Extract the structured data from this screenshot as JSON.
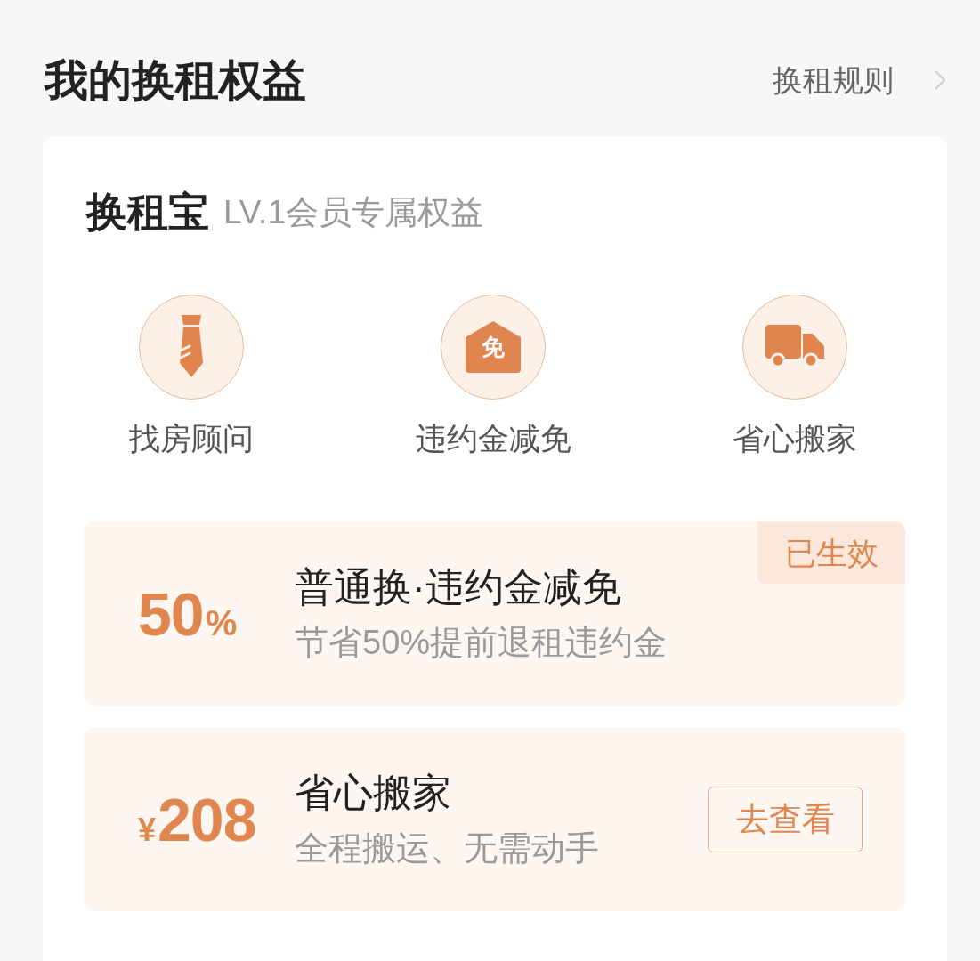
{
  "header": {
    "title": "我的换租权益",
    "link": "换租规则"
  },
  "card": {
    "name": "换租宝",
    "subtitle": "LV.1会员专属权益",
    "perks": [
      {
        "kind": "advisor",
        "label": "找房顾问"
      },
      {
        "kind": "waiver",
        "icon_text": "免",
        "label": "违约金减免"
      },
      {
        "kind": "moving",
        "label": "省心搬家"
      }
    ],
    "benefits": [
      {
        "number": "50",
        "suffix": "%",
        "title": "普通换·违约金减免",
        "description": "节省50%提前退租违约金",
        "badge": "已生效"
      },
      {
        "prefix": "¥",
        "number": "208",
        "title": "省心搬家",
        "description": "全程搬运、无需动手",
        "button": "去查看"
      }
    ]
  }
}
